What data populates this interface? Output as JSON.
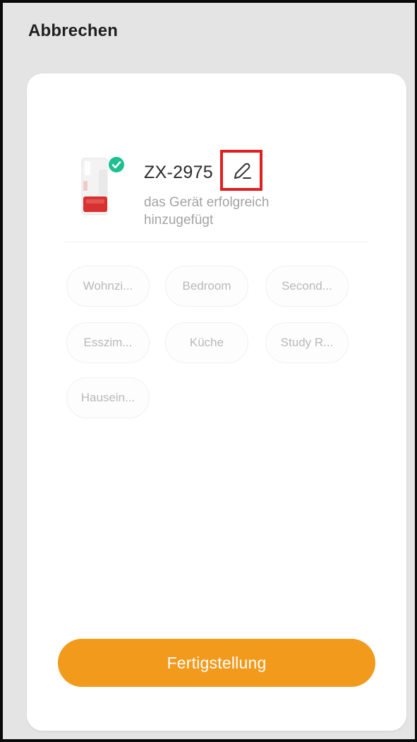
{
  "header": {
    "cancel_label": "Abbrechen"
  },
  "device": {
    "name": "ZX-2975",
    "status": "das Gerät erfolgreich hinzugefügt",
    "image_icon": "siren-device-icon",
    "check_icon": "check-circle-icon",
    "edit_icon": "pencil-icon"
  },
  "rooms": [
    {
      "label": "Wohnzi..."
    },
    {
      "label": "Bedroom"
    },
    {
      "label": "Second..."
    },
    {
      "label": "Esszim..."
    },
    {
      "label": "Küche"
    },
    {
      "label": "Study R..."
    },
    {
      "label": "Hausein..."
    }
  ],
  "actions": {
    "finish_label": "Fertigstellung"
  },
  "colors": {
    "accent": "#f29a1c",
    "success": "#1fbf8f",
    "highlight": "#e01f1f",
    "background": "#e4e4e4"
  }
}
